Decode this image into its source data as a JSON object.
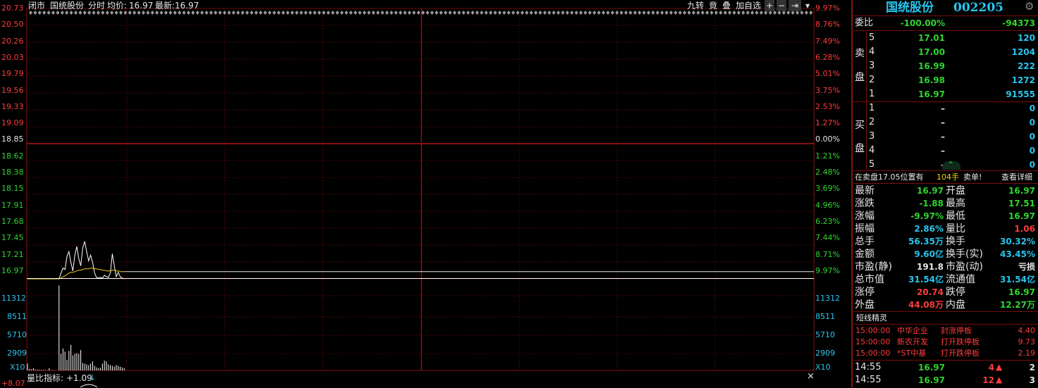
{
  "header": {
    "status": "闭市",
    "name": "国统股份",
    "mode": "分时",
    "avg_label": "均价:",
    "avg_value": "16.97",
    "last_label": "最新:",
    "last_value": "16.97",
    "buttons": [
      "九转",
      "竟",
      "叠",
      "加自选",
      "+",
      "−",
      "⇥",
      "▾"
    ]
  },
  "price_axis": {
    "left": [
      "20.73",
      "20.50",
      "20.26",
      "20.03",
      "19.79",
      "19.56",
      "19.33",
      "19.09",
      "18.85",
      "18.62",
      "18.38",
      "18.15",
      "17.91",
      "17.68",
      "17.45",
      "17.21",
      "16.97"
    ],
    "right": [
      "9.97%",
      "8.76%",
      "7.49%",
      "6.28%",
      "5.01%",
      "3.75%",
      "2.53%",
      "1.27%",
      "0.00%",
      "1.21%",
      "2.48%",
      "3.69%",
      "4.96%",
      "6.23%",
      "7.44%",
      "8.71%",
      "9.97%"
    ]
  },
  "volume_axis": {
    "labels": [
      "11312",
      "8511",
      "5710",
      "2909"
    ],
    "scale": "X10"
  },
  "bottom_bar": {
    "indicator": "量比指标:",
    "value": "+1.09",
    "arrow": "↓",
    "corner": "+8.07",
    "close": "×"
  },
  "panel": {
    "title": "国统股份",
    "code": "002205",
    "weibi_label": "委比",
    "weibi_pct": "-100.00%",
    "weibi_diff": "-94373",
    "sell_label": [
      "卖",
      "盘"
    ],
    "buy_label": [
      "买",
      "盘"
    ],
    "sell": [
      {
        "lvl": "5",
        "price": "17.01",
        "vol": "120"
      },
      {
        "lvl": "4",
        "price": "17.00",
        "vol": "1204"
      },
      {
        "lvl": "3",
        "price": "16.99",
        "vol": "222"
      },
      {
        "lvl": "2",
        "price": "16.98",
        "vol": "1272"
      },
      {
        "lvl": "1",
        "price": "16.97",
        "vol": "91555"
      }
    ],
    "buy": [
      {
        "lvl": "1",
        "price": "–",
        "vol": "0"
      },
      {
        "lvl": "2",
        "price": "–",
        "vol": "0"
      },
      {
        "lvl": "3",
        "price": "–",
        "vol": "0"
      },
      {
        "lvl": "4",
        "price": "–",
        "vol": "0"
      },
      {
        "lvl": "5",
        "price": "–",
        "vol": "0"
      }
    ],
    "queue": {
      "text": "在卖盘17.05位置有",
      "hands": "104手",
      "action": "卖单!",
      "detail": "查看详细"
    },
    "stats": [
      {
        "l1": "最新",
        "v1": "16.97",
        "c1": "green",
        "l2": "开盘",
        "v2": "16.97",
        "c2": "green"
      },
      {
        "l1": "涨跌",
        "v1": "-1.88",
        "c1": "green",
        "l2": "最高",
        "v2": "17.51",
        "c2": "green"
      },
      {
        "l1": "涨幅",
        "v1": "-9.97%",
        "c1": "green",
        "l2": "最低",
        "v2": "16.97",
        "c2": "green"
      },
      {
        "l1": "振幅",
        "v1": "2.86%",
        "c1": "cyan",
        "l2": "量比",
        "v2": "1.06",
        "c2": "red"
      },
      {
        "l1": "总手",
        "v1": "56.35万",
        "c1": "cyan",
        "l2": "换手",
        "v2": "30.32%",
        "c2": "cyan"
      },
      {
        "l1": "金额",
        "v1": "9.60亿",
        "c1": "cyan",
        "l2": "换手(实)",
        "v2": "43.45%",
        "c2": "cyan"
      },
      {
        "l1": "市盈(静)",
        "v1": "191.8",
        "c1": "white",
        "l2": "市盈(动)",
        "v2": "亏损",
        "c2": "white"
      },
      {
        "l1": "总市值",
        "v1": "31.54亿",
        "c1": "cyan",
        "l2": "流通值",
        "v2": "31.54亿",
        "c2": "cyan"
      },
      {
        "l1": "涨停",
        "v1": "20.74",
        "c1": "red",
        "l2": "跌停",
        "v2": "16.97",
        "c2": "green"
      },
      {
        "l1": "外盘",
        "v1": "44.08万",
        "c1": "red",
        "l2": "内盘",
        "v2": "12.27万",
        "c2": "green"
      }
    ],
    "short_title": "短线精灵",
    "short_list": [
      {
        "time": "15:00:00",
        "name": "中华企业",
        "event": "封涨停板",
        "val": "4.40"
      },
      {
        "time": "15:00:00",
        "name": "新农开发",
        "event": "打开跌停板",
        "val": "9.73"
      },
      {
        "time": "15:00:00",
        "name": "*ST中基",
        "event": "打开跌停板",
        "val": "2.19"
      }
    ],
    "ticks": [
      {
        "time": "14:55",
        "price": "16.97",
        "vol": "4",
        "n": "2"
      },
      {
        "time": "14:55",
        "price": "16.97",
        "vol": "12",
        "n": "3"
      }
    ]
  },
  "chart_data": {
    "type": "line",
    "y_range_price": [
      16.97,
      20.73
    ],
    "prev_close": 18.85,
    "price_series": [
      16.97,
      16.97,
      16.97,
      16.97,
      16.97,
      16.97,
      16.97,
      16.97,
      16.97,
      16.97,
      16.97,
      16.97,
      16.97,
      16.97,
      16.97,
      16.97,
      16.97,
      17.05,
      17.12,
      17.1,
      17.28,
      17.35,
      17.2,
      17.08,
      17.3,
      17.42,
      17.25,
      17.15,
      17.4,
      17.49,
      17.35,
      17.22,
      17.3,
      17.2,
      17.05,
      16.99,
      16.98,
      16.99,
      16.98,
      17.02,
      17.0,
      16.99,
      17.05,
      17.32,
      17.15,
      17.0,
      17.06,
      17.0,
      16.98,
      16.97
    ],
    "avg_series": [
      16.97,
      16.97,
      16.97,
      16.97,
      16.97,
      16.97,
      16.97,
      16.97,
      16.97,
      16.97,
      16.97,
      16.97,
      16.97,
      16.97,
      16.97,
      16.97,
      16.97,
      16.98,
      17.0,
      17.01,
      17.03,
      17.05,
      17.06,
      17.06,
      17.07,
      17.08,
      17.09,
      17.09,
      17.1,
      17.11,
      17.11,
      17.11,
      17.12,
      17.12,
      17.11,
      17.11,
      17.1,
      17.1,
      17.09,
      17.09,
      17.08,
      17.08,
      17.08,
      17.09,
      17.09,
      17.08,
      17.08,
      17.07,
      17.07,
      17.07
    ],
    "volume_x10": [
      900,
      200,
      150,
      300,
      120,
      100,
      90,
      80,
      70,
      60,
      50,
      300,
      40,
      30,
      20,
      15,
      11312,
      2200,
      2900,
      2500,
      1400,
      2600,
      3400,
      2000,
      2200,
      2300,
      2200,
      2700,
      1000,
      900,
      800,
      700,
      900,
      1200,
      600,
      400,
      300,
      350,
      900,
      1300,
      1200,
      800,
      700,
      600,
      500,
      700,
      600,
      500,
      400,
      300
    ]
  }
}
